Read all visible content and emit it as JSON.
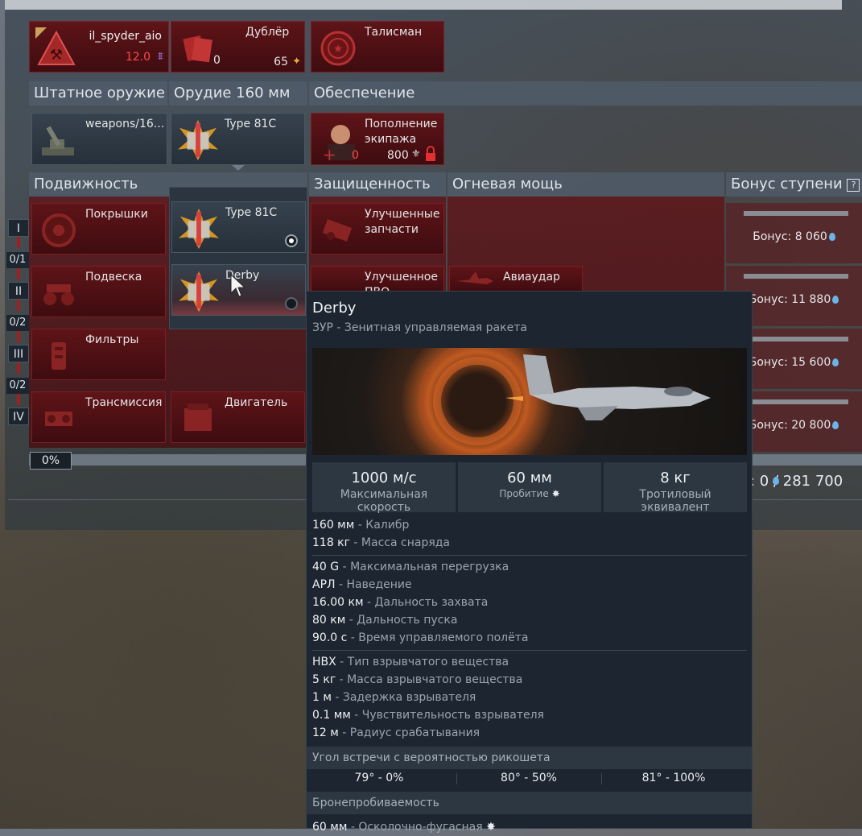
{
  "top_row": {
    "player": {
      "name": "il_spyder_aio",
      "rating": "12.0"
    },
    "backup": {
      "label": "Дублёр",
      "count": "0",
      "cost": "65"
    },
    "talisman": {
      "label": "Талисман"
    }
  },
  "weapon_headers": [
    "Штатное оружие",
    "Орудие 160 мм",
    "Обеспечение"
  ],
  "weapon_cards": {
    "standard": "weapons/16...",
    "gun": "Type 81C",
    "crew": {
      "label1": "Пополнение",
      "label2": "экипажа",
      "count": "0",
      "cost": "800"
    }
  },
  "mod_headers": [
    "Подвижность",
    "Защищенность",
    "Огневая мощь",
    "Бонус ступени"
  ],
  "mobility": [
    "Покрышки",
    "Подвеска",
    "Фильтры",
    "Трансмиссия"
  ],
  "engine": "Двигатель",
  "dropdown": [
    "Type 81C",
    "Derby"
  ],
  "protection": [
    "Улучшенные запчасти",
    "Улучшенное ПВО"
  ],
  "firepower": [
    "Авиаудар"
  ],
  "ranks": [
    "I",
    "II",
    "III",
    "IV"
  ],
  "rank_counts": [
    "0/1",
    "0/2",
    "0/2"
  ],
  "bonuses": [
    "Бонус: 8 060",
    "Бонус: 11 880",
    "Бонус: 15 600",
    "Бонус: 20 800"
  ],
  "progress": {
    "label": "0%",
    "value": 0
  },
  "research": ": 0 / 281 700",
  "tooltip": {
    "title": "Derby",
    "subtitle": "ЗУР - Зенитная управляемая ракета",
    "stats": [
      {
        "value": "1000 м/с",
        "label": "Максимальная скорость"
      },
      {
        "value": "60 мм",
        "label": "Пробитие"
      },
      {
        "value": "8 кг",
        "label": "Тротиловый эквивалент"
      }
    ],
    "group1": [
      {
        "a": "160 мм",
        "b": " - Калибр"
      },
      {
        "a": "118 кг",
        "b": " - Масса снаряда"
      }
    ],
    "group2": [
      {
        "a": "40 G",
        "b": " - Максимальная перегрузка"
      },
      {
        "a": "АРЛ",
        "b": " - Наведение"
      },
      {
        "a": "16.00 км",
        "b": " - Дальность захвата"
      },
      {
        "a": "80 км",
        "b": " - Дальность пуска"
      },
      {
        "a": "90.0 с",
        "b": " - Время управляемого полёта"
      }
    ],
    "group3": [
      {
        "a": "HBX",
        "b": " - Тип взрывчатого вещества"
      },
      {
        "a": "5 кг",
        "b": " - Масса взрывчатого вещества"
      },
      {
        "a": "1 м",
        "b": " - Задержка взрывателя"
      },
      {
        "a": "0.1 мм",
        "b": " - Чувствительность взрывателя"
      },
      {
        "a": "12 м",
        "b": " - Радиус срабатывания"
      }
    ],
    "ricochet_title": "Угол встречи с вероятностью рикошета",
    "ricochet": [
      "79° - 0%",
      "80° - 50%",
      "81° - 100%"
    ],
    "pen_title": "Бронепробиваемость",
    "pen_row": {
      "a": "60 мм",
      "b": " - Осколочно-фугасная"
    }
  },
  "colors": {
    "accent_red": "#e03030",
    "panel_red": "#5e1418",
    "bonus_icon": "#6ab4e8"
  }
}
